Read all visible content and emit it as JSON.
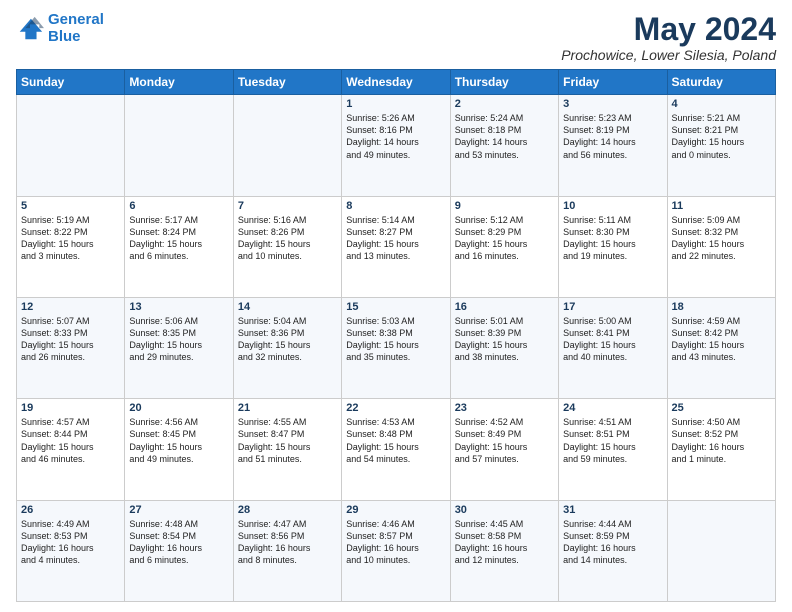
{
  "logo": {
    "line1": "General",
    "line2": "Blue"
  },
  "title": "May 2024",
  "location": "Prochowice, Lower Silesia, Poland",
  "headers": [
    "Sunday",
    "Monday",
    "Tuesday",
    "Wednesday",
    "Thursday",
    "Friday",
    "Saturday"
  ],
  "weeks": [
    [
      {
        "day": "",
        "lines": []
      },
      {
        "day": "",
        "lines": []
      },
      {
        "day": "",
        "lines": []
      },
      {
        "day": "1",
        "lines": [
          "Sunrise: 5:26 AM",
          "Sunset: 8:16 PM",
          "Daylight: 14 hours",
          "and 49 minutes."
        ]
      },
      {
        "day": "2",
        "lines": [
          "Sunrise: 5:24 AM",
          "Sunset: 8:18 PM",
          "Daylight: 14 hours",
          "and 53 minutes."
        ]
      },
      {
        "day": "3",
        "lines": [
          "Sunrise: 5:23 AM",
          "Sunset: 8:19 PM",
          "Daylight: 14 hours",
          "and 56 minutes."
        ]
      },
      {
        "day": "4",
        "lines": [
          "Sunrise: 5:21 AM",
          "Sunset: 8:21 PM",
          "Daylight: 15 hours",
          "and 0 minutes."
        ]
      }
    ],
    [
      {
        "day": "5",
        "lines": [
          "Sunrise: 5:19 AM",
          "Sunset: 8:22 PM",
          "Daylight: 15 hours",
          "and 3 minutes."
        ]
      },
      {
        "day": "6",
        "lines": [
          "Sunrise: 5:17 AM",
          "Sunset: 8:24 PM",
          "Daylight: 15 hours",
          "and 6 minutes."
        ]
      },
      {
        "day": "7",
        "lines": [
          "Sunrise: 5:16 AM",
          "Sunset: 8:26 PM",
          "Daylight: 15 hours",
          "and 10 minutes."
        ]
      },
      {
        "day": "8",
        "lines": [
          "Sunrise: 5:14 AM",
          "Sunset: 8:27 PM",
          "Daylight: 15 hours",
          "and 13 minutes."
        ]
      },
      {
        "day": "9",
        "lines": [
          "Sunrise: 5:12 AM",
          "Sunset: 8:29 PM",
          "Daylight: 15 hours",
          "and 16 minutes."
        ]
      },
      {
        "day": "10",
        "lines": [
          "Sunrise: 5:11 AM",
          "Sunset: 8:30 PM",
          "Daylight: 15 hours",
          "and 19 minutes."
        ]
      },
      {
        "day": "11",
        "lines": [
          "Sunrise: 5:09 AM",
          "Sunset: 8:32 PM",
          "Daylight: 15 hours",
          "and 22 minutes."
        ]
      }
    ],
    [
      {
        "day": "12",
        "lines": [
          "Sunrise: 5:07 AM",
          "Sunset: 8:33 PM",
          "Daylight: 15 hours",
          "and 26 minutes."
        ]
      },
      {
        "day": "13",
        "lines": [
          "Sunrise: 5:06 AM",
          "Sunset: 8:35 PM",
          "Daylight: 15 hours",
          "and 29 minutes."
        ]
      },
      {
        "day": "14",
        "lines": [
          "Sunrise: 5:04 AM",
          "Sunset: 8:36 PM",
          "Daylight: 15 hours",
          "and 32 minutes."
        ]
      },
      {
        "day": "15",
        "lines": [
          "Sunrise: 5:03 AM",
          "Sunset: 8:38 PM",
          "Daylight: 15 hours",
          "and 35 minutes."
        ]
      },
      {
        "day": "16",
        "lines": [
          "Sunrise: 5:01 AM",
          "Sunset: 8:39 PM",
          "Daylight: 15 hours",
          "and 38 minutes."
        ]
      },
      {
        "day": "17",
        "lines": [
          "Sunrise: 5:00 AM",
          "Sunset: 8:41 PM",
          "Daylight: 15 hours",
          "and 40 minutes."
        ]
      },
      {
        "day": "18",
        "lines": [
          "Sunrise: 4:59 AM",
          "Sunset: 8:42 PM",
          "Daylight: 15 hours",
          "and 43 minutes."
        ]
      }
    ],
    [
      {
        "day": "19",
        "lines": [
          "Sunrise: 4:57 AM",
          "Sunset: 8:44 PM",
          "Daylight: 15 hours",
          "and 46 minutes."
        ]
      },
      {
        "day": "20",
        "lines": [
          "Sunrise: 4:56 AM",
          "Sunset: 8:45 PM",
          "Daylight: 15 hours",
          "and 49 minutes."
        ]
      },
      {
        "day": "21",
        "lines": [
          "Sunrise: 4:55 AM",
          "Sunset: 8:47 PM",
          "Daylight: 15 hours",
          "and 51 minutes."
        ]
      },
      {
        "day": "22",
        "lines": [
          "Sunrise: 4:53 AM",
          "Sunset: 8:48 PM",
          "Daylight: 15 hours",
          "and 54 minutes."
        ]
      },
      {
        "day": "23",
        "lines": [
          "Sunrise: 4:52 AM",
          "Sunset: 8:49 PM",
          "Daylight: 15 hours",
          "and 57 minutes."
        ]
      },
      {
        "day": "24",
        "lines": [
          "Sunrise: 4:51 AM",
          "Sunset: 8:51 PM",
          "Daylight: 15 hours",
          "and 59 minutes."
        ]
      },
      {
        "day": "25",
        "lines": [
          "Sunrise: 4:50 AM",
          "Sunset: 8:52 PM",
          "Daylight: 16 hours",
          "and 1 minute."
        ]
      }
    ],
    [
      {
        "day": "26",
        "lines": [
          "Sunrise: 4:49 AM",
          "Sunset: 8:53 PM",
          "Daylight: 16 hours",
          "and 4 minutes."
        ]
      },
      {
        "day": "27",
        "lines": [
          "Sunrise: 4:48 AM",
          "Sunset: 8:54 PM",
          "Daylight: 16 hours",
          "and 6 minutes."
        ]
      },
      {
        "day": "28",
        "lines": [
          "Sunrise: 4:47 AM",
          "Sunset: 8:56 PM",
          "Daylight: 16 hours",
          "and 8 minutes."
        ]
      },
      {
        "day": "29",
        "lines": [
          "Sunrise: 4:46 AM",
          "Sunset: 8:57 PM",
          "Daylight: 16 hours",
          "and 10 minutes."
        ]
      },
      {
        "day": "30",
        "lines": [
          "Sunrise: 4:45 AM",
          "Sunset: 8:58 PM",
          "Daylight: 16 hours",
          "and 12 minutes."
        ]
      },
      {
        "day": "31",
        "lines": [
          "Sunrise: 4:44 AM",
          "Sunset: 8:59 PM",
          "Daylight: 16 hours",
          "and 14 minutes."
        ]
      },
      {
        "day": "",
        "lines": []
      }
    ]
  ]
}
